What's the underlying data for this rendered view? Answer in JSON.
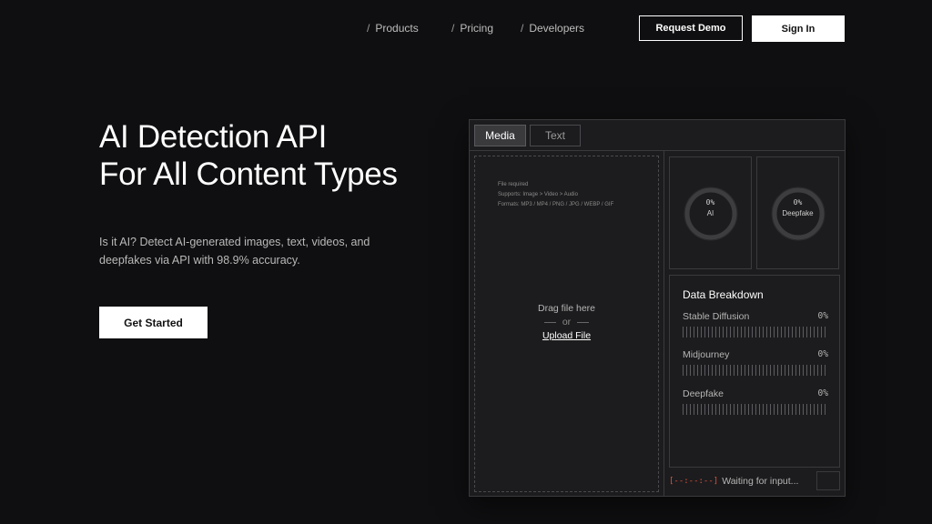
{
  "nav": {
    "links": [
      {
        "slash": "/",
        "label": "Products"
      },
      {
        "slash": "/",
        "label": "Pricing"
      },
      {
        "slash": "/",
        "label": "Developers"
      }
    ],
    "request_demo": "Request Demo",
    "sign_in": "Sign In"
  },
  "hero": {
    "title_line1": "AI Detection API",
    "title_line2": "For All Content Types",
    "description": "Is it AI? Detect AI-generated images, text, videos, and deepfakes via API with 98.9% accuracy.",
    "cta": "Get Started"
  },
  "panel": {
    "tabs": [
      {
        "label": "Media",
        "active": true
      },
      {
        "label": "Text",
        "active": false
      }
    ],
    "dropzone": {
      "info": [
        "File required",
        "Supports: Image > Video > Audio",
        "Formats: MP3 / MP4 / PNG / JPG / WEBP / GIF"
      ],
      "drag": "Drag file here",
      "or": "or",
      "upload": "Upload File"
    },
    "scores": [
      {
        "percent": "0%",
        "label": "AI",
        "value": 0
      },
      {
        "percent": "0%",
        "label": "Deepfake",
        "value": 0
      }
    ],
    "breakdown": {
      "title": "Data Breakdown",
      "rows": [
        {
          "label": "Stable Diffusion",
          "percent": "0%"
        },
        {
          "label": "Midjourney",
          "percent": "0%"
        },
        {
          "label": "Deepfake",
          "percent": "0%"
        }
      ]
    },
    "status": {
      "timestamp": "[--:--:--]",
      "message": "Waiting for input..."
    }
  },
  "colors": {
    "background": "#0f0f11",
    "panel": "#1c1c1e",
    "timestamp": "#e0523d",
    "ring": "#3d3d40"
  }
}
